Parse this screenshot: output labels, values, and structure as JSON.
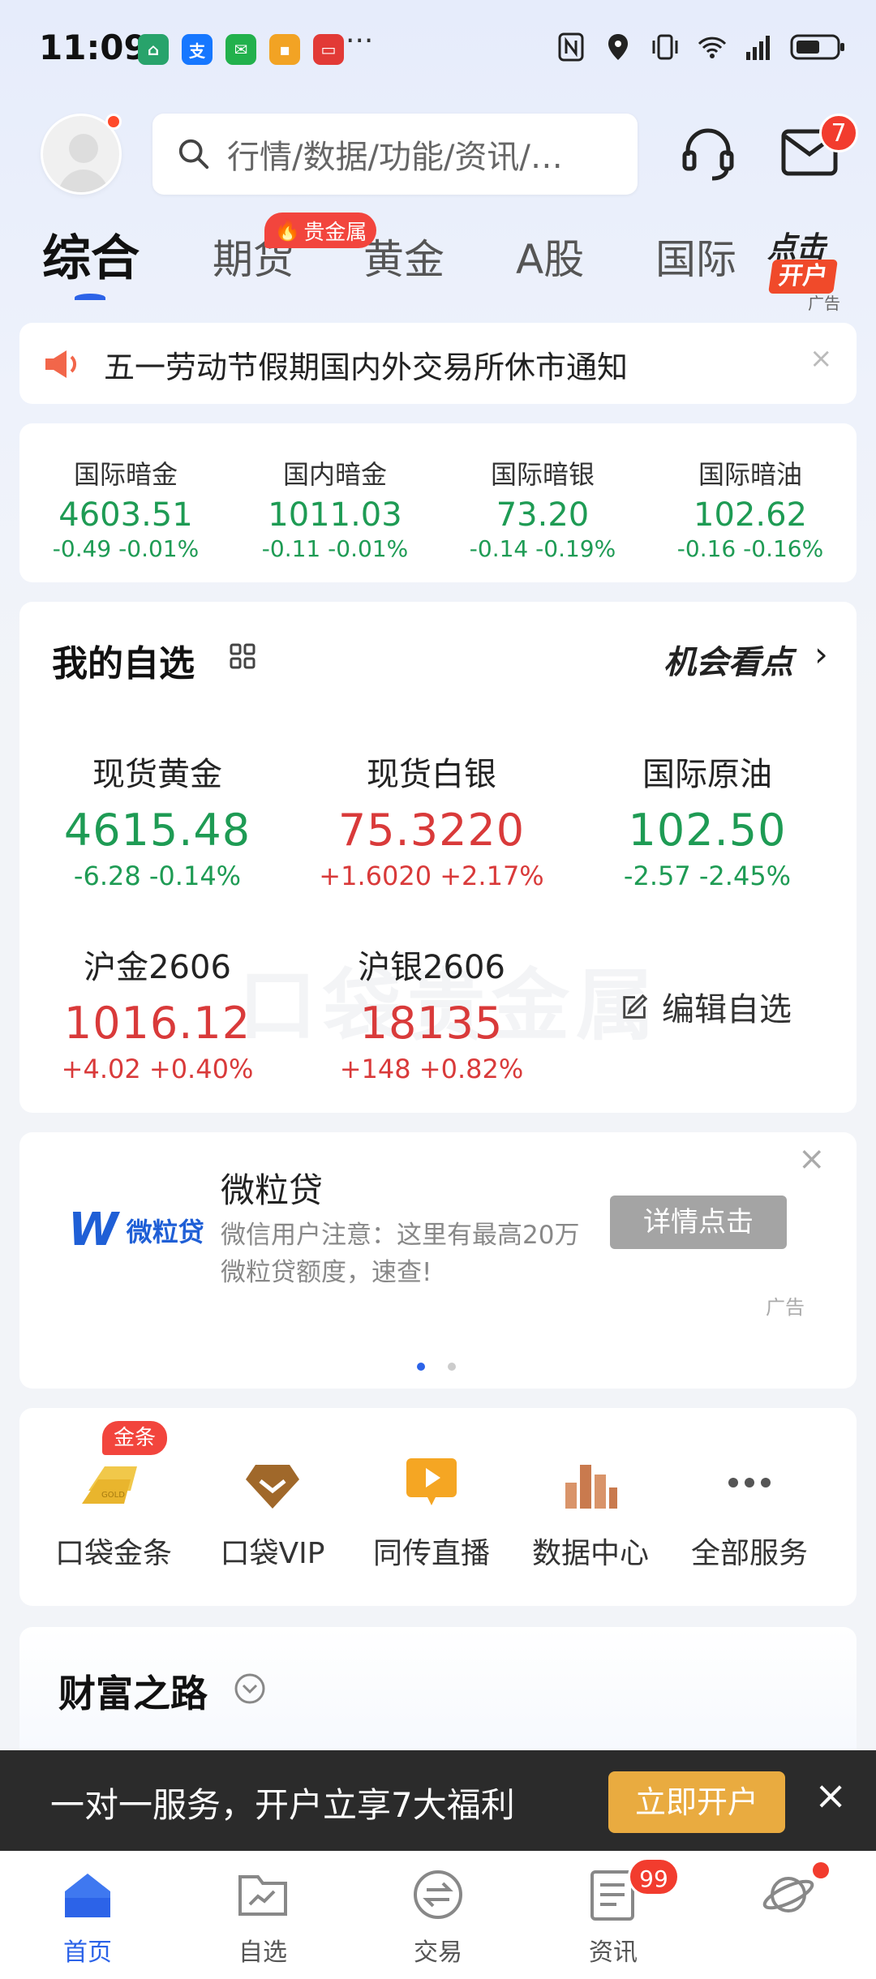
{
  "status": {
    "time": "11:09",
    "more": "···"
  },
  "header": {
    "search_placeholder": "行情/数据/功能/资讯/…",
    "mail_badge": "7"
  },
  "tabs": [
    {
      "label": "综合",
      "active": true
    },
    {
      "label": "期货"
    },
    {
      "label": "黄金"
    },
    {
      "label": "A股"
    },
    {
      "label": "国际"
    }
  ],
  "tab_badge": "贵金属",
  "tab_ad": {
    "top": "点击",
    "btn": "开户",
    "cap": "广告"
  },
  "notice": {
    "text": "五一劳动节假期国内外交易所休市通知",
    "close": "×"
  },
  "ticker": [
    {
      "name": "国际暗金",
      "price": "4603.51",
      "change": "-0.49  -0.01%"
    },
    {
      "name": "国内暗金",
      "price": "1011.03",
      "change": "-0.11  -0.01%"
    },
    {
      "name": "国际暗银",
      "price": "73.20",
      "change": "-0.14  -0.19%"
    },
    {
      "name": "国际暗油",
      "price": "102.62",
      "change": "-0.16  -0.16%"
    }
  ],
  "watchlist": {
    "title": "我的自选",
    "opportunity": "机会看点",
    "edit_label": "编辑自选",
    "watermark": "口袋贵金属",
    "items": [
      {
        "name": "现货黄金",
        "price": "4615.48",
        "change": "-6.28  -0.14%",
        "trend": "down"
      },
      {
        "name": "现货白银",
        "price": "75.3220",
        "change": "+1.6020  +2.17%",
        "trend": "up"
      },
      {
        "name": "国际原油",
        "price": "102.50",
        "change": "-2.57  -2.45%",
        "trend": "down"
      },
      {
        "name": "沪金2606",
        "price": "1016.12",
        "change": "+4.02  +0.40%",
        "trend": "up"
      },
      {
        "name": "沪银2606",
        "price": "18135",
        "change": "+148  +0.82%",
        "trend": "up"
      }
    ]
  },
  "ad": {
    "logo_text": "微粒贷",
    "title": "微粒贷",
    "desc": "微信用户注意：这里有最高20万微粒贷额度，速查!",
    "button": "详情点击",
    "label": "广告",
    "close": "×"
  },
  "services": [
    {
      "label": "口袋金条",
      "icon": "gold-bar-icon"
    },
    {
      "label": "口袋VIP",
      "icon": "vip-diamond-icon"
    },
    {
      "label": "同传直播",
      "icon": "live-play-icon"
    },
    {
      "label": "数据中心",
      "icon": "bar-chart-icon"
    },
    {
      "label": "全部服务",
      "icon": "more-dots-icon"
    }
  ],
  "services_badge": "金条",
  "wealth": {
    "title": "财富之路"
  },
  "banner": {
    "text": "一对一服务，开户立享7大福利",
    "button": "立即开户",
    "close": "×"
  },
  "nav": [
    {
      "label": "首页",
      "active": true
    },
    {
      "label": "自选"
    },
    {
      "label": "交易"
    },
    {
      "label": "资讯"
    },
    {
      "label": ""
    }
  ],
  "nav_badge": "99",
  "colors": {
    "accent": "#2c63e8",
    "up": "#d93a3a",
    "down": "#1e9b54",
    "badge": "#f23c2e",
    "cta": "#e9ab40"
  }
}
